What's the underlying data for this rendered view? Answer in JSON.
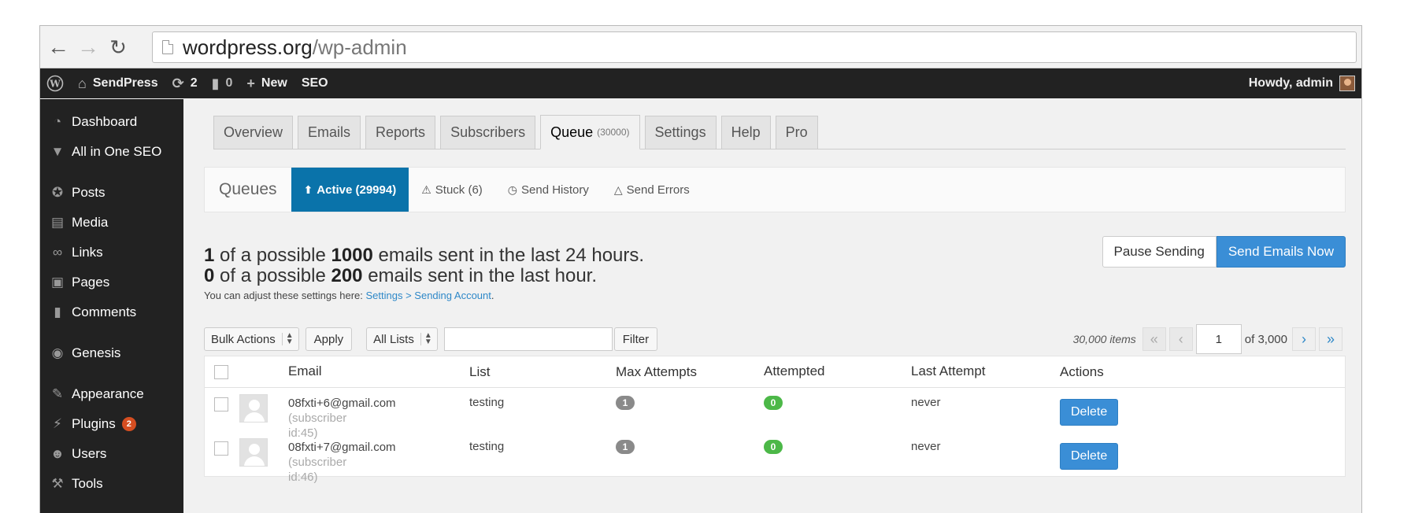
{
  "browser": {
    "url_host": "wordpress.org",
    "url_path": "/wp-admin"
  },
  "adminbar": {
    "site_name": "SendPress",
    "updates_count": "2",
    "comments_count": "0",
    "new_label": "New",
    "seo_label": "SEO",
    "howdy": "Howdy, admin"
  },
  "sidebar": {
    "items": [
      {
        "label": "Dashboard",
        "icon": "dashboard-icon"
      },
      {
        "label": "All in One SEO",
        "icon": "shield-icon"
      },
      {
        "label": "Posts",
        "icon": "pin-icon"
      },
      {
        "label": "Media",
        "icon": "media-icon"
      },
      {
        "label": "Links",
        "icon": "link-icon"
      },
      {
        "label": "Pages",
        "icon": "pages-icon"
      },
      {
        "label": "Comments",
        "icon": "comment-icon"
      },
      {
        "label": "Genesis",
        "icon": "genesis-icon"
      },
      {
        "label": "Appearance",
        "icon": "brush-icon"
      },
      {
        "label": "Plugins",
        "icon": "plug-icon",
        "badge": "2"
      },
      {
        "label": "Users",
        "icon": "user-icon"
      },
      {
        "label": "Tools",
        "icon": "wrench-icon"
      }
    ]
  },
  "tabs": [
    {
      "label": "Overview"
    },
    {
      "label": "Emails"
    },
    {
      "label": "Reports"
    },
    {
      "label": "Subscribers"
    },
    {
      "label": "Queue",
      "count": "(30000)"
    },
    {
      "label": "Settings"
    },
    {
      "label": "Help"
    },
    {
      "label": "Pro"
    }
  ],
  "subnav": {
    "brand": "Queues",
    "items": [
      {
        "label": "Active (29994)"
      },
      {
        "label": "Stuck (6)"
      },
      {
        "label": "Send History"
      },
      {
        "label": "Send Errors"
      }
    ]
  },
  "stats": {
    "line1_num": "1",
    "line1_mid": "of a possible",
    "line1_max": "1000",
    "line1_tail": "emails sent in the last 24 hours.",
    "line2_num": "0",
    "line2_mid": "of a possible",
    "line2_max": "200",
    "line2_tail": "emails sent in the last hour.",
    "adjust_text": "You can adjust these settings here:",
    "adjust_link": "Settings > Sending Account",
    "adjust_end": "."
  },
  "actions": {
    "pause": "Pause Sending",
    "send": "Send Emails Now"
  },
  "toolbar": {
    "bulk": "Bulk Actions",
    "apply": "Apply",
    "lists": "All Lists",
    "filter": "Filter",
    "items_count": "30,000 items",
    "page": "1",
    "of_pages": "of 3,000",
    "first": "«",
    "prev": "‹",
    "next": "›",
    "last": "»"
  },
  "table": {
    "headers": {
      "email": "Email",
      "list": "List",
      "max": "Max Attempts",
      "attempted": "Attempted",
      "last": "Last Attempt",
      "actions": "Actions"
    },
    "rows": [
      {
        "email": "08fxti+6@gmail.com",
        "sub1": "(subscriber",
        "sub2": "id:45)",
        "list": "testing",
        "max": "1",
        "attempted": "0",
        "last": "never",
        "delete": "Delete"
      },
      {
        "email": "08fxti+7@gmail.com",
        "sub1": "(subscriber",
        "sub2": "id:46)",
        "list": "testing",
        "max": "1",
        "attempted": "0",
        "last": "never",
        "delete": "Delete"
      }
    ]
  }
}
